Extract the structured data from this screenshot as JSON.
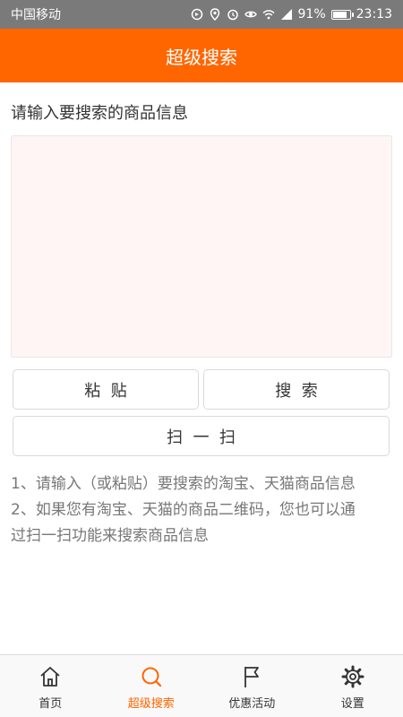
{
  "status_bar": {
    "carrier": "中国移动",
    "battery": "91%",
    "battery_level": 0.91,
    "time": "23:13",
    "network": "4G"
  },
  "header": {
    "title": "超级搜索"
  },
  "search": {
    "prompt": "请输入要搜索的商品信息",
    "input_value": "",
    "paste_label": "粘  贴",
    "search_label": "搜  索",
    "scan_label": "扫  一  扫"
  },
  "help": {
    "lines": [
      "1、请输入（或粘贴）要搜索的淘宝、天猫商品信息",
      "2、如果您有淘宝、天猫的商品二维码，您也可以通",
      "过扫一扫功能来搜索商品信息"
    ]
  },
  "tabs": [
    {
      "label": "首页",
      "icon": "home-icon"
    },
    {
      "label": "超级搜索",
      "icon": "search-icon",
      "active": true
    },
    {
      "label": "优惠活动",
      "icon": "flag-icon"
    },
    {
      "label": "设置",
      "icon": "gear-icon"
    }
  ],
  "colors": {
    "accent": "#ff6600",
    "status_bar": "#7a7a7a",
    "input_bg": "#fff5f5",
    "help_text": "#777777"
  }
}
